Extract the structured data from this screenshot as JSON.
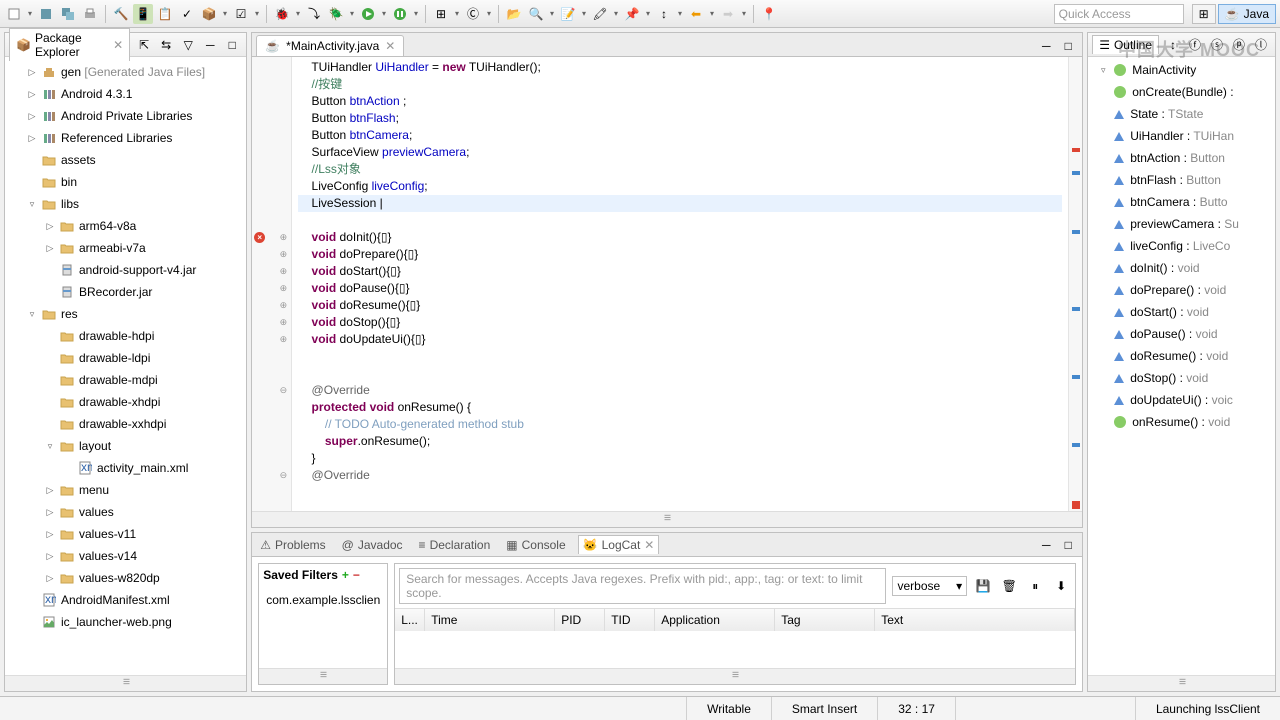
{
  "toolbar": {
    "quick_access": "Quick Access"
  },
  "perspective": {
    "java": "Java"
  },
  "package_explorer": {
    "title": "Package Explorer",
    "items": [
      {
        "indent": 1,
        "twist": "▷",
        "icon": "pkg",
        "label": "gen",
        "suffix": " [Generated Java Files]",
        "gray": true
      },
      {
        "indent": 1,
        "twist": "▷",
        "icon": "lib",
        "label": "Android 4.3.1"
      },
      {
        "indent": 1,
        "twist": "▷",
        "icon": "lib",
        "label": "Android Private Libraries"
      },
      {
        "indent": 1,
        "twist": "▷",
        "icon": "lib",
        "label": "Referenced Libraries"
      },
      {
        "indent": 1,
        "twist": "",
        "icon": "folder",
        "label": "assets"
      },
      {
        "indent": 1,
        "twist": "",
        "icon": "folder",
        "label": "bin"
      },
      {
        "indent": 1,
        "twist": "▿",
        "icon": "folder",
        "label": "libs"
      },
      {
        "indent": 2,
        "twist": "▷",
        "icon": "folder",
        "label": "arm64-v8a"
      },
      {
        "indent": 2,
        "twist": "▷",
        "icon": "folder",
        "label": "armeabi-v7a"
      },
      {
        "indent": 2,
        "twist": "",
        "icon": "jar",
        "label": "android-support-v4.jar"
      },
      {
        "indent": 2,
        "twist": "",
        "icon": "jar",
        "label": "BRecorder.jar"
      },
      {
        "indent": 1,
        "twist": "▿",
        "icon": "folder",
        "label": "res"
      },
      {
        "indent": 2,
        "twist": "",
        "icon": "folder",
        "label": "drawable-hdpi"
      },
      {
        "indent": 2,
        "twist": "",
        "icon": "folder",
        "label": "drawable-ldpi"
      },
      {
        "indent": 2,
        "twist": "",
        "icon": "folder",
        "label": "drawable-mdpi"
      },
      {
        "indent": 2,
        "twist": "",
        "icon": "folder",
        "label": "drawable-xhdpi"
      },
      {
        "indent": 2,
        "twist": "",
        "icon": "folder",
        "label": "drawable-xxhdpi"
      },
      {
        "indent": 2,
        "twist": "▿",
        "icon": "folder",
        "label": "layout"
      },
      {
        "indent": 3,
        "twist": "",
        "icon": "xml",
        "label": "activity_main.xml"
      },
      {
        "indent": 2,
        "twist": "▷",
        "icon": "folder",
        "label": "menu"
      },
      {
        "indent": 2,
        "twist": "▷",
        "icon": "folder",
        "label": "values"
      },
      {
        "indent": 2,
        "twist": "▷",
        "icon": "folder",
        "label": "values-v11"
      },
      {
        "indent": 2,
        "twist": "▷",
        "icon": "folder",
        "label": "values-v14"
      },
      {
        "indent": 2,
        "twist": "▷",
        "icon": "folder",
        "label": "values-w820dp"
      },
      {
        "indent": 1,
        "twist": "",
        "icon": "xml",
        "label": "AndroidManifest.xml"
      },
      {
        "indent": 1,
        "twist": "",
        "icon": "img",
        "label": "ic_launcher-web.png"
      }
    ]
  },
  "editor": {
    "tab": "*MainActivity.java",
    "lines": [
      {
        "g": "",
        "html": "    TUiHandler <span class='fld'>UiHandler</span> = <span class='kw'>new</span> TUiHandler();"
      },
      {
        "g": "",
        "html": "    <span class='cm'>//按键</span>"
      },
      {
        "g": "",
        "html": "    Button <span class='fld'>btnAction</span> ;"
      },
      {
        "g": "",
        "html": "    Button <span class='fld'>btnFlash</span>;"
      },
      {
        "g": "",
        "html": "    Button <span class='fld'>btnCamera</span>;"
      },
      {
        "g": "",
        "html": "    SurfaceView <span class='fld'>previewCamera</span>;"
      },
      {
        "g": "",
        "html": "    <span class='cm'>//Lss对象</span>"
      },
      {
        "g": "",
        "html": "    LiveConfig <span class='fld'>liveConfig</span>;"
      },
      {
        "g": "",
        "html": "<span class='hl'>    LiveSession |</span>"
      },
      {
        "g": "",
        "html": ""
      },
      {
        "g": "err",
        "fold": "⊕",
        "html": "    <span class='kw'>void</span> doInit(){▯}"
      },
      {
        "g": "",
        "fold": "⊕",
        "html": "    <span class='kw'>void</span> doPrepare(){▯}"
      },
      {
        "g": "",
        "fold": "⊕",
        "html": "    <span class='kw'>void</span> doStart(){▯}"
      },
      {
        "g": "",
        "fold": "⊕",
        "html": "    <span class='kw'>void</span> doPause(){▯}"
      },
      {
        "g": "",
        "fold": "⊕",
        "html": "    <span class='kw'>void</span> doResume(){▯}"
      },
      {
        "g": "",
        "fold": "⊕",
        "html": "    <span class='kw'>void</span> doStop(){▯}"
      },
      {
        "g": "",
        "fold": "⊕",
        "html": "    <span class='kw'>void</span> doUpdateUi(){▯}"
      },
      {
        "g": "",
        "html": ""
      },
      {
        "g": "",
        "html": ""
      },
      {
        "g": "",
        "fold": "⊖",
        "html": "    <span class='an'>@Override</span>"
      },
      {
        "g": "",
        "html": "    <span class='kw'>protected</span> <span class='kw'>void</span> onResume() {"
      },
      {
        "g": "",
        "html": "        <span class='tcm'>// TODO Auto-generated method stub</span>"
      },
      {
        "g": "",
        "html": "        <span class='kw'>super</span>.onResume();"
      },
      {
        "g": "",
        "html": "    }"
      },
      {
        "g": "",
        "fold": "⊖",
        "html": "    <span class='an'>@Override</span>"
      }
    ]
  },
  "outline": {
    "title": "Outline",
    "root": "MainActivity",
    "items": [
      {
        "icon": "method-pub",
        "label": "onCreate(Bundle) :"
      },
      {
        "icon": "field",
        "label": "State : ",
        "type": "TState"
      },
      {
        "icon": "field",
        "label": "UiHandler : ",
        "type": "TUiHan"
      },
      {
        "icon": "field",
        "label": "btnAction : ",
        "type": "Button"
      },
      {
        "icon": "field",
        "label": "btnFlash : ",
        "type": "Button"
      },
      {
        "icon": "field",
        "label": "btnCamera : ",
        "type": "Butto"
      },
      {
        "icon": "field",
        "label": "previewCamera : ",
        "type": "Su"
      },
      {
        "icon": "field",
        "label": "liveConfig : ",
        "type": "LiveCo"
      },
      {
        "icon": "method",
        "label": "doInit() : ",
        "type": "void"
      },
      {
        "icon": "method",
        "label": "doPrepare() : ",
        "type": "void"
      },
      {
        "icon": "method",
        "label": "doStart() : ",
        "type": "void"
      },
      {
        "icon": "method",
        "label": "doPause() : ",
        "type": "void"
      },
      {
        "icon": "method",
        "label": "doResume() : ",
        "type": "void"
      },
      {
        "icon": "method",
        "label": "doStop() : ",
        "type": "void"
      },
      {
        "icon": "method",
        "label": "doUpdateUi() : ",
        "type": "voic"
      },
      {
        "icon": "method-pub",
        "label": "onResume() : ",
        "type": "void"
      }
    ]
  },
  "bottom": {
    "tabs": [
      "Problems",
      "Javadoc",
      "Declaration",
      "Console",
      "LogCat"
    ],
    "active": 4,
    "saved_filters": "Saved Filters",
    "filter_item": "com.example.lssclien",
    "search_placeholder": "Search for messages. Accepts Java regexes. Prefix with pid:, app:, tag: or text: to limit scope.",
    "level": "verbose",
    "columns": [
      "L...",
      "Time",
      "PID",
      "TID",
      "Application",
      "Tag",
      "Text"
    ]
  },
  "status": {
    "writable": "Writable",
    "insert": "Smart Insert",
    "pos": "32 : 17",
    "launch": "Launching lssClient"
  },
  "watermark": "中国大学 MOOC"
}
